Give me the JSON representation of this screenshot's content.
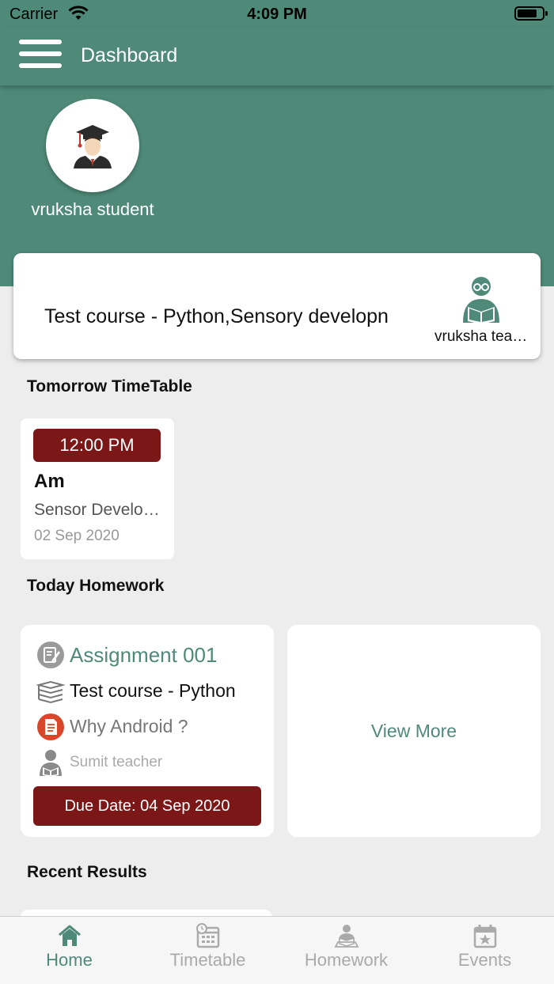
{
  "status_bar": {
    "carrier": "Carrier",
    "time": "4:09 PM"
  },
  "nav": {
    "title": "Dashboard"
  },
  "profile": {
    "name": "vruksha student"
  },
  "course_card": {
    "course": "Test course - Python,Sensory developn",
    "teacher": "vruksha teacher"
  },
  "sections": {
    "timetable": "Tomorrow TimeTable",
    "homework": "Today Homework",
    "results": "Recent Results"
  },
  "timetable": [
    {
      "time": "12:00 PM",
      "subject": "Am",
      "topic": "Sensor Development",
      "date": "02 Sep 2020"
    }
  ],
  "homework": [
    {
      "title": "Assignment 001",
      "course": "Test course - Python",
      "question": "Why Android ?",
      "teacher": "Sumit teacher",
      "due": "Due Date: 04 Sep 2020"
    }
  ],
  "view_more": "View More",
  "tabs": [
    {
      "label": "Home",
      "icon": "home-icon",
      "active": true
    },
    {
      "label": "Timetable",
      "icon": "calendar-clock-icon",
      "active": false
    },
    {
      "label": "Homework",
      "icon": "reading-student-icon",
      "active": false
    },
    {
      "label": "Events",
      "icon": "event-calendar-icon",
      "active": false
    }
  ],
  "colors": {
    "primary": "#4f8a78",
    "accent": "#7c1718",
    "background": "#ededed"
  }
}
